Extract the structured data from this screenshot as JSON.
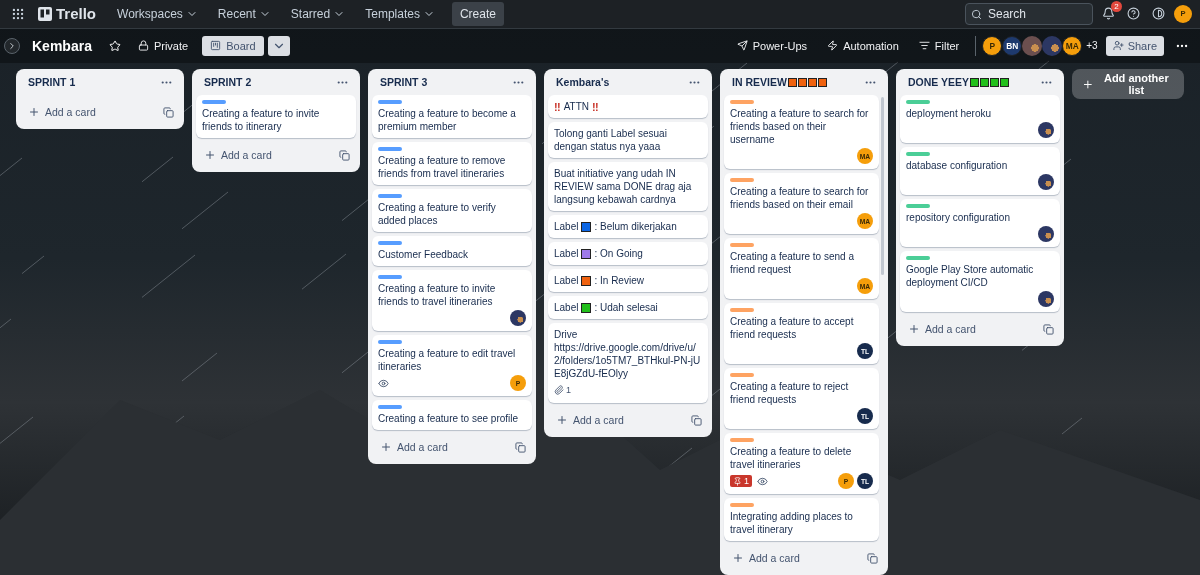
{
  "top_bar": {
    "app_name": "Trello",
    "nav": [
      {
        "label": "Workspaces"
      },
      {
        "label": "Recent"
      },
      {
        "label": "Starred"
      },
      {
        "label": "Templates"
      }
    ],
    "create": "Create",
    "search": {
      "placeholder": "Search"
    },
    "notifications": "2",
    "user": {
      "initials": "P",
      "color": "#f59e0b"
    }
  },
  "board_bar": {
    "title": "Kembara",
    "visibility": "Private",
    "view": {
      "label": "Board",
      "selected": true
    },
    "actions": [
      {
        "kind": "power-ups",
        "label": "Power-Ups"
      },
      {
        "kind": "automation",
        "label": "Automation"
      },
      {
        "kind": "filter",
        "label": "Filter"
      }
    ],
    "members": [
      {
        "kind": "initials",
        "initials": "P",
        "color": "#f59e0b"
      },
      {
        "kind": "initials",
        "initials": "BN",
        "color": "#1e3a6e"
      },
      {
        "kind": "photo",
        "color": "#6b4f4f"
      },
      {
        "kind": "photo",
        "color": "#2c3763"
      },
      {
        "kind": "initials",
        "initials": "MA",
        "color": "#f59e0b"
      }
    ],
    "more_members": "+3",
    "share": "Share"
  },
  "lists": [
    {
      "title": "SPRINT 1",
      "add_card": "Add a card"
    },
    {
      "title": "SPRINT 2",
      "cards": [
        {
          "kind": "task",
          "label": {
            "color": "#579dff"
          },
          "text": "Creating a feature to invite friends to itinerary"
        }
      ],
      "add_card": "Add a card"
    },
    {
      "title": "SPRINT 3",
      "cards": [
        {
          "kind": "task",
          "label": {
            "color": "#579dff"
          },
          "text": "Creating a feature to become a premium member"
        },
        {
          "kind": "task",
          "label": {
            "color": "#579dff"
          },
          "text": "Creating a feature to remove friends from travel itineraries"
        },
        {
          "kind": "task",
          "label": {
            "color": "#579dff"
          },
          "text": "Creating a feature to verify added places"
        },
        {
          "kind": "task",
          "label": {
            "color": "#579dff"
          },
          "text": "Customer Feedback"
        },
        {
          "kind": "task",
          "label": {
            "color": "#579dff"
          },
          "text": "Creating a feature to invite friends to travel itineraries",
          "members": [
            {
              "kind": "photo",
              "color": "#2c3763"
            }
          ]
        },
        {
          "kind": "task",
          "label": {
            "color": "#579dff"
          },
          "text": "Creating a feature to edit travel itineraries",
          "badges": [
            {
              "kind": "watch"
            }
          ],
          "members": [
            {
              "kind": "initials",
              "initials": "P",
              "color": "#f59e0b"
            }
          ]
        },
        {
          "kind": "task",
          "label": {
            "color": "#579dff"
          },
          "text": "Creating a feature to see profile"
        }
      ],
      "add_card": "Add a card"
    },
    {
      "title": "Kembara's",
      "cards": [
        {
          "kind": "alert",
          "mark": "‼",
          "text": "ATTN"
        },
        {
          "kind": "note",
          "text": "Tolong ganti Label sesuai dengan status nya yaaa"
        },
        {
          "kind": "note",
          "text": "Buat initiative yang udah IN REVIEW sama DONE drag aja langsung kebawah cardnya"
        },
        {
          "kind": "legend",
          "text": "Label",
          "swatch": {
            "color": "#0c66e4"
          },
          "caption": ": Belum dikerjakan"
        },
        {
          "kind": "legend",
          "text": "Label",
          "swatch": {
            "color": "#9f7aea"
          },
          "caption": ": On Going"
        },
        {
          "kind": "legend",
          "text": "Label",
          "swatch": {
            "color": "#f0620f"
          },
          "caption": ": In Review"
        },
        {
          "kind": "legend",
          "text": "Label",
          "swatch": {
            "color": "#22c01b"
          },
          "caption": ": Udah selesai"
        },
        {
          "kind": "link",
          "text": "Drive",
          "url": "https://drive.google.com/drive/u/2/folders/1o5TM7_BTHkul-PN-jUE8jGZdU-fEOlyy",
          "badges": [
            {
              "kind": "attachment",
              "count": "1"
            }
          ]
        }
      ],
      "add_card": "Add a card"
    },
    {
      "title": "IN REVIEW",
      "title_marks": [
        {
          "color": "#f0620f"
        },
        {
          "color": "#f0620f"
        },
        {
          "color": "#f0620f"
        },
        {
          "color": "#f0620f"
        }
      ],
      "scrollable": true,
      "cards": [
        {
          "kind": "task",
          "label": {
            "color": "#fea362"
          },
          "text": "Creating a feature to search for friends based on their username",
          "members": [
            {
              "kind": "initials",
              "initials": "MA",
              "color": "#f59e0b"
            }
          ]
        },
        {
          "kind": "task",
          "label": {
            "color": "#fea362"
          },
          "text": "Creating a feature to search for friends based on their email",
          "members": [
            {
              "kind": "initials",
              "initials": "MA",
              "color": "#f59e0b"
            }
          ]
        },
        {
          "kind": "task",
          "label": {
            "color": "#fea362"
          },
          "text": "Creating a feature to send a friend request",
          "members": [
            {
              "kind": "initials",
              "initials": "MA",
              "color": "#f59e0b"
            }
          ]
        },
        {
          "kind": "task",
          "label": {
            "color": "#fea362"
          },
          "text": "Creating a feature to accept friend requests",
          "members": [
            {
              "kind": "initials",
              "initials": "TL",
              "color": "#172b4d"
            }
          ]
        },
        {
          "kind": "task",
          "label": {
            "color": "#fea362"
          },
          "text": "Creating a feature to reject friend requests",
          "members": [
            {
              "kind": "initials",
              "initials": "TL",
              "color": "#172b4d"
            }
          ]
        },
        {
          "kind": "task",
          "label": {
            "color": "#fea362"
          },
          "text": "Creating a feature to delete travel itineraries",
          "badges": [
            {
              "kind": "pin",
              "count": "1"
            },
            {
              "kind": "watch"
            }
          ],
          "members": [
            {
              "kind": "initials",
              "initials": "P",
              "color": "#f59e0b"
            },
            {
              "kind": "initials",
              "initials": "TL",
              "color": "#172b4d"
            }
          ]
        },
        {
          "kind": "task",
          "label": {
            "color": "#fea362"
          },
          "text": "Integrating adding places to travel itinerary"
        }
      ],
      "add_card": "Add a card"
    },
    {
      "title": "DONE YEEY",
      "title_marks": [
        {
          "color": "#22c01b"
        },
        {
          "color": "#22c01b"
        },
        {
          "color": "#22c01b"
        },
        {
          "color": "#22c01b"
        }
      ],
      "cards": [
        {
          "kind": "task",
          "label": {
            "color": "#4bce97"
          },
          "text": "deployment heroku",
          "members": [
            {
              "kind": "photo",
              "color": "#2c3763"
            }
          ]
        },
        {
          "kind": "task",
          "label": {
            "color": "#4bce97"
          },
          "text": "database configuration",
          "members": [
            {
              "kind": "photo",
              "color": "#2c3763"
            }
          ]
        },
        {
          "kind": "task",
          "label": {
            "color": "#4bce97"
          },
          "text": "repository configuration",
          "members": [
            {
              "kind": "photo",
              "color": "#2c3763"
            }
          ]
        },
        {
          "kind": "task",
          "label": {
            "color": "#4bce97"
          },
          "text": "Google Play Store automatic deployment CI/CD",
          "members": [
            {
              "kind": "photo",
              "color": "#2c3763"
            }
          ]
        }
      ],
      "add_card": "Add a card"
    }
  ],
  "add_list": "Add another list"
}
